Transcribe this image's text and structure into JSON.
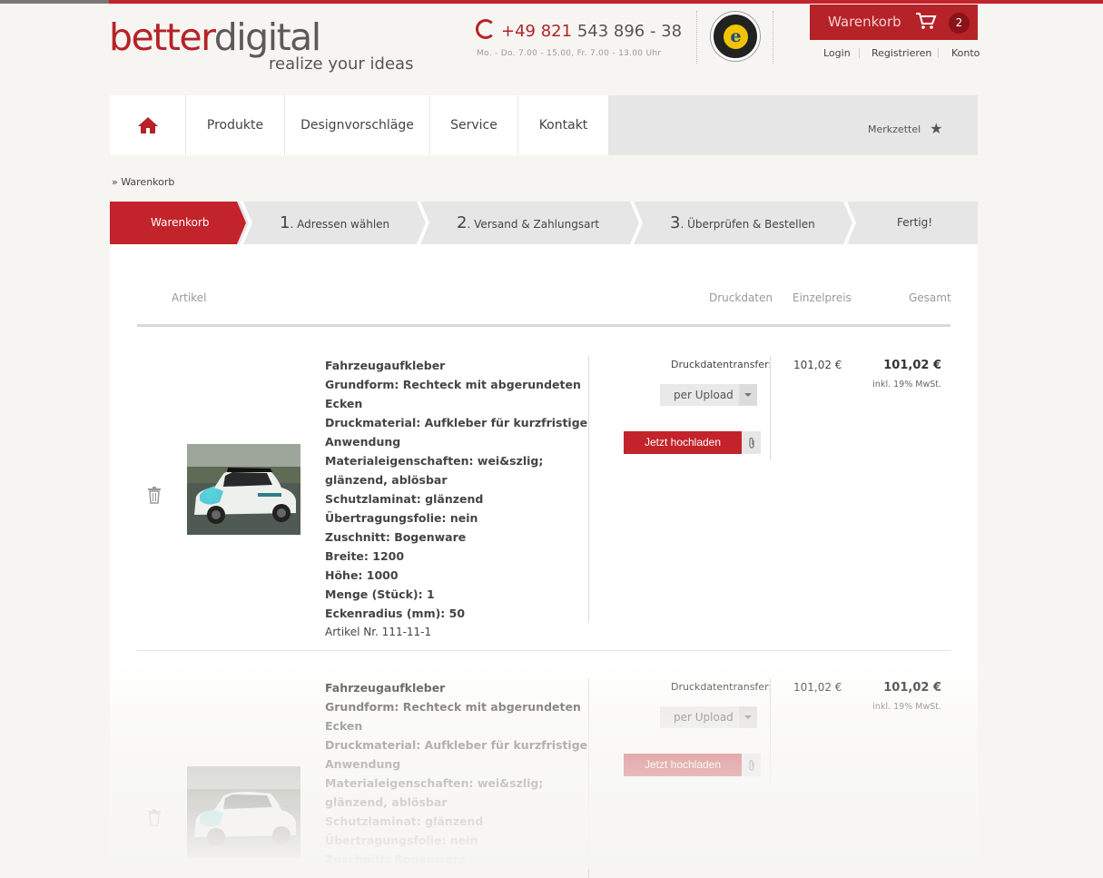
{
  "brand": {
    "logo_part1": "better",
    "logo_part2": "digital",
    "tagline": "realize your ideas"
  },
  "contact": {
    "phone_prefix": "+49 821",
    "phone_number": "543 896 - 38",
    "hours": "Mo. - Do. 7.00 - 15.00, Fr. 7.00 - 13.00 Uhr"
  },
  "trust_badge": {
    "letter": "e",
    "name": "TRUSTED SHOPS GUARANTEE"
  },
  "cart": {
    "label": "Warenkorb",
    "count": "2"
  },
  "account_links": [
    "Login",
    "Registrieren",
    "Konto"
  ],
  "nav": {
    "items": [
      "Produkte",
      "Designvorschläge",
      "Service",
      "Kontakt"
    ],
    "wishlist": "Merkzettel"
  },
  "breadcrumb": {
    "prefix": "»",
    "current": "Warenkorb"
  },
  "steps": [
    {
      "num": "",
      "label": "Warenkorb"
    },
    {
      "num": "1",
      "label": ". Adressen wählen"
    },
    {
      "num": "2",
      "label": ". Versand & Zahlungsart"
    },
    {
      "num": "3",
      "label": ". Überprüfen & Bestellen"
    },
    {
      "num": "",
      "label": "Fertig!"
    }
  ],
  "table_headers": {
    "article": "Artikel",
    "print_data": "Druckdaten",
    "unit_price": "Einzelpreis",
    "total": "Gesamt"
  },
  "items": [
    {
      "name": "Fahrzeugaufkleber",
      "props": [
        "Grundform: Rechteck mit abgerundeten Ecken",
        "Druckmaterial: Aufkleber für kurzfristige Anwendung",
        "Materialeigenschaften: wei&szlig; glänzend, ablösbar",
        "Schutzlaminat: glänzend",
        "Übertragungsfolie: nein",
        "Zuschnitt: Bogenware",
        "Breite: 1200",
        "Höhe: 1000",
        "Menge (Stück): 1",
        "Eckenradius (mm): 50"
      ],
      "article_no": "Artikel Nr. 111-11-1",
      "transfer_label": "Druckdatentransfer:",
      "transfer_value": "per Upload",
      "upload_label": "Jetzt hochladen",
      "unit_price": "101,02 €",
      "total": "101,02 €",
      "vat": "inkl. 19% MwSt."
    },
    {
      "name": "Fahrzeugaufkleber",
      "props": [
        "Grundform: Rechteck mit abgerundeten Ecken",
        "Druckmaterial: Aufkleber für kurzfristige Anwendung",
        "Materialeigenschaften: wei&szlig; glänzend, ablösbar",
        "Schutzlaminat: glänzend",
        "Übertragungsfolie: nein",
        "Zuschnitt: Bogenware"
      ],
      "transfer_label": "Druckdatentransfer:",
      "transfer_value": "per Upload",
      "upload_label": "Jetzt hochladen",
      "unit_price": "101,02 €",
      "total": "101,02 €",
      "vat": "inkl. 19% MwSt."
    }
  ],
  "colors": {
    "brand_red": "#b52228",
    "button_red": "#c3232a",
    "nav_grey": "#e6e6e6"
  }
}
